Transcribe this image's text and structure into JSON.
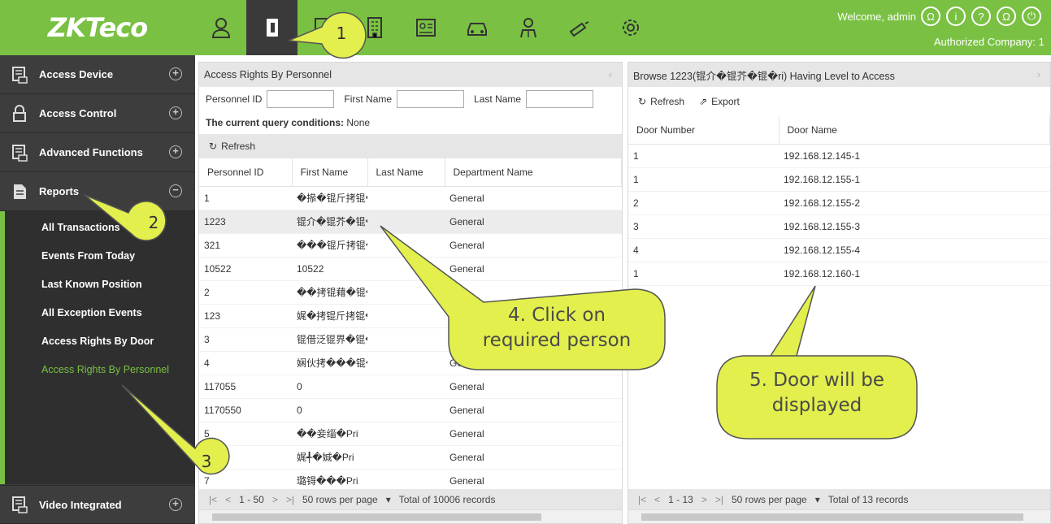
{
  "brand": {
    "logo": "ZKTeco"
  },
  "header": {
    "welcome": "Welcome, admin",
    "company": "Authorized Company: 1",
    "top_icons": [
      "personnel-icon",
      "access-icon",
      "elevator-icon",
      "building-icon",
      "id-card-icon",
      "car-icon",
      "visitor-icon",
      "patrol-icon",
      "settings-icon"
    ],
    "right_icons": [
      "user-circle-icon",
      "info-icon",
      "help-icon",
      "account-icon",
      "power-icon"
    ]
  },
  "sidebar": {
    "menus": [
      {
        "label": "Access Device"
      },
      {
        "label": "Access Control"
      },
      {
        "label": "Advanced Functions"
      },
      {
        "label": "Reports"
      }
    ],
    "submenu": [
      {
        "label": "All Transactions"
      },
      {
        "label": "Events From Today"
      },
      {
        "label": "Last Known Position"
      },
      {
        "label": "All Exception Events"
      },
      {
        "label": "Access Rights By Door"
      },
      {
        "label": "Access Rights By Personnel"
      }
    ],
    "bottom_menu": {
      "label": "Video Integrated"
    }
  },
  "left_panel": {
    "title": "Access Rights By Personnel",
    "filter": {
      "personnel_id_label": "Personnel ID",
      "first_name_label": "First Name",
      "last_name_label": "Last Name"
    },
    "conditions_label": "The current query conditions:",
    "conditions_value": "None",
    "refresh_label": "Refresh",
    "columns": [
      "Personnel ID",
      "First Name",
      "Last Name",
      "Department Name"
    ],
    "rows": [
      [
        "1",
        "�撡�锟斤拷锟�",
        "",
        "General"
      ],
      [
        "1223",
        "锟介�锟芥�锟�",
        "",
        "General"
      ],
      [
        "321",
        "���锟斤拷锟�",
        "",
        "General"
      ],
      [
        "10522",
        "10522",
        "",
        "General"
      ],
      [
        "2",
        "��拷锟藉�锟�",
        "",
        ""
      ],
      [
        "123",
        "娓�拷锟斤拷锟�",
        "",
        ""
      ],
      [
        "3",
        "锟借泛锟界�锟�",
        "",
        ""
      ],
      [
        "4",
        "娴伙拷���锟�",
        "",
        "General"
      ],
      [
        "117055",
        "0",
        "",
        "General"
      ],
      [
        "1170550",
        "0",
        "",
        "General"
      ],
      [
        "5",
        "��妾缁�Pri",
        "",
        "General"
      ],
      [
        "6",
        "娓╃�娍�Pri",
        "",
        "General"
      ],
      [
        "7",
        "璐锝���Pri",
        "",
        "General"
      ]
    ],
    "pager": {
      "range": "1 - 50",
      "per_page": "50 rows per page",
      "total": "Total of 10006 records"
    }
  },
  "right_panel": {
    "title": "Browse 1223(锟介�锟芥�锟�ri) Having Level to Access",
    "refresh_label": "Refresh",
    "export_label": "Export",
    "columns": [
      "Door Number",
      "Door Name"
    ],
    "rows": [
      [
        "1",
        "192.168.12.145-1"
      ],
      [
        "1",
        "192.168.12.155-1"
      ],
      [
        "2",
        "192.168.12.155-2"
      ],
      [
        "3",
        "192.168.12.155-3"
      ],
      [
        "4",
        "192.168.12.155-4"
      ],
      [
        "1",
        "192.168.12.160-1"
      ]
    ],
    "pager": {
      "range": "1 - 13",
      "per_page": "50 rows per page",
      "total": "Total of 13 records"
    }
  },
  "callouts": {
    "n1": "1",
    "n2": "2",
    "n3": "3",
    "c4_line1": "4. Click on",
    "c4_line2": "required person",
    "c5_line1": "5. Door will be",
    "c5_line2": "displayed",
    "fill": "#e2ef4c"
  },
  "colors": {
    "brand_green": "#7ac143",
    "sidebar": "#3d3d3d",
    "callout": "#e2ef4c"
  }
}
